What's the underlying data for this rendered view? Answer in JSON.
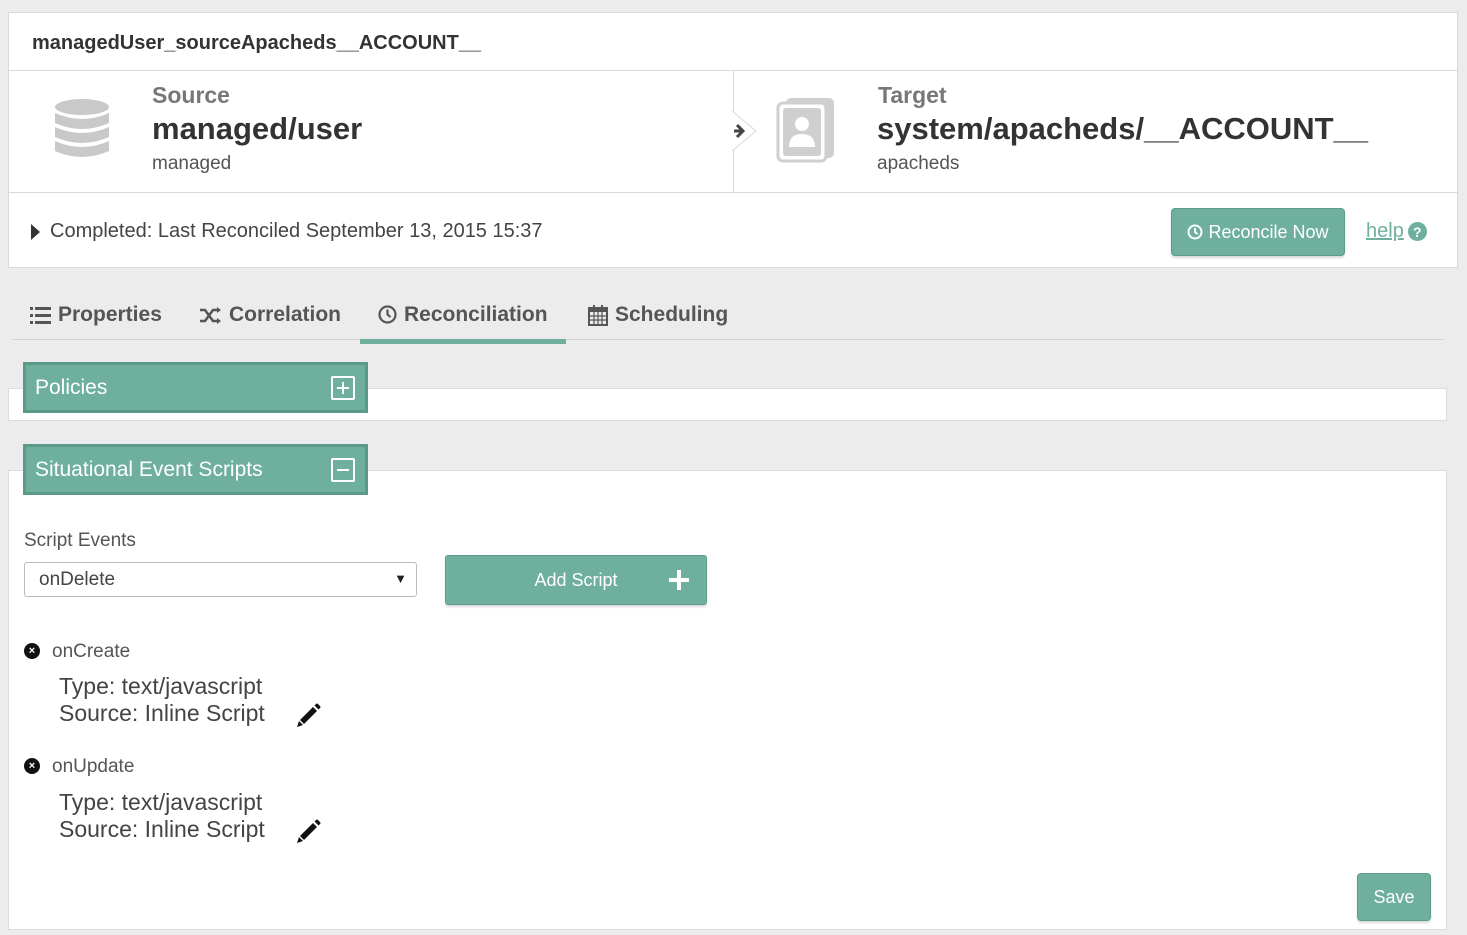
{
  "mapping": {
    "title": "managedUser_sourceApacheds__ACCOUNT__",
    "source": {
      "label": "Source",
      "name": "managed/user",
      "type": "managed",
      "icon": "database-icon"
    },
    "target": {
      "label": "Target",
      "name": "system/apacheds/__ACCOUNT__",
      "type": "apacheds",
      "icon": "contact-card-icon"
    },
    "status": "Completed: Last Reconciled September 13, 2015 15:37",
    "reconcile_label": "Reconcile Now",
    "help_label": "help"
  },
  "tabs": [
    {
      "label": "Properties",
      "icon": "list-icon"
    },
    {
      "label": "Correlation",
      "icon": "shuffle-icon"
    },
    {
      "label": "Reconciliation",
      "icon": "clock-icon",
      "active": true
    },
    {
      "label": "Scheduling",
      "icon": "calendar-icon"
    }
  ],
  "policies": {
    "title": "Policies",
    "expanded": false
  },
  "situational": {
    "title": "Situational Event Scripts",
    "expanded": true,
    "script_events_label": "Script Events",
    "selected_event": "onDelete",
    "add_script_label": "Add Script",
    "scripts": [
      {
        "event": "onCreate",
        "type": "Type: text/javascript",
        "source": "Source: Inline Script"
      },
      {
        "event": "onUpdate",
        "type": "Type: text/javascript",
        "source": "Source: Inline Script"
      }
    ]
  },
  "save_label": "Save",
  "colors": {
    "accent": "#6faf9e",
    "accent_border": "#5a9a89",
    "background": "#ececec"
  }
}
